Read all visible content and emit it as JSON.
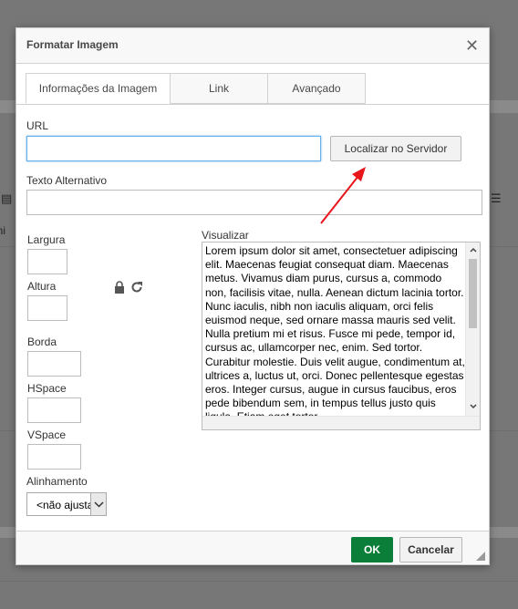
{
  "background": {
    "glyph_left": "ani"
  },
  "dialog": {
    "title": "Formatar Imagem",
    "close_icon": "close-icon",
    "tabs": [
      {
        "label": "Informações da Imagem",
        "active": true
      },
      {
        "label": "Link",
        "active": false
      },
      {
        "label": "Avançado",
        "active": false
      }
    ],
    "url": {
      "label": "URL",
      "value": ""
    },
    "browse_button": "Localizar no Servidor",
    "alt_text": {
      "label": "Texto Alternativo",
      "value": ""
    },
    "width": {
      "label": "Largura",
      "value": ""
    },
    "height": {
      "label": "Altura",
      "value": ""
    },
    "lock_icon": "lock-icon",
    "reset_icon": "refresh-icon",
    "border": {
      "label": "Borda",
      "value": ""
    },
    "hspace": {
      "label": "HSpace",
      "value": ""
    },
    "vspace": {
      "label": "VSpace",
      "value": ""
    },
    "align": {
      "label": "Alinhamento",
      "selected": "<não ajustado>"
    },
    "preview": {
      "label": "Visualizar",
      "text": "Lorem ipsum dolor sit amet, consectetuer adipiscing elit. Maecenas feugiat consequat diam. Maecenas metus. Vivamus diam purus, cursus a, commodo non, facilisis vitae, nulla. Aenean dictum lacinia tortor. Nunc iaculis, nibh non iaculis aliquam, orci felis euismod neque, sed ornare massa mauris sed velit. Nulla pretium mi et risus. Fusce mi pede, tempor id, cursus ac, ullamcorper nec, enim. Sed tortor. Curabitur molestie. Duis velit augue, condimentum at, ultrices a, luctus ut, orci. Donec pellentesque egestas eros. Integer cursus, augue in cursus faucibus, eros pede bibendum sem, in tempus tellus justo quis ligula. Etiam eget tortor."
    },
    "ok_button": "OK",
    "cancel_button": "Cancelar"
  },
  "colors": {
    "ok_green": "#0b7e3a",
    "annotation_red": "#e8161b",
    "focus_blue": "#66afe9"
  }
}
